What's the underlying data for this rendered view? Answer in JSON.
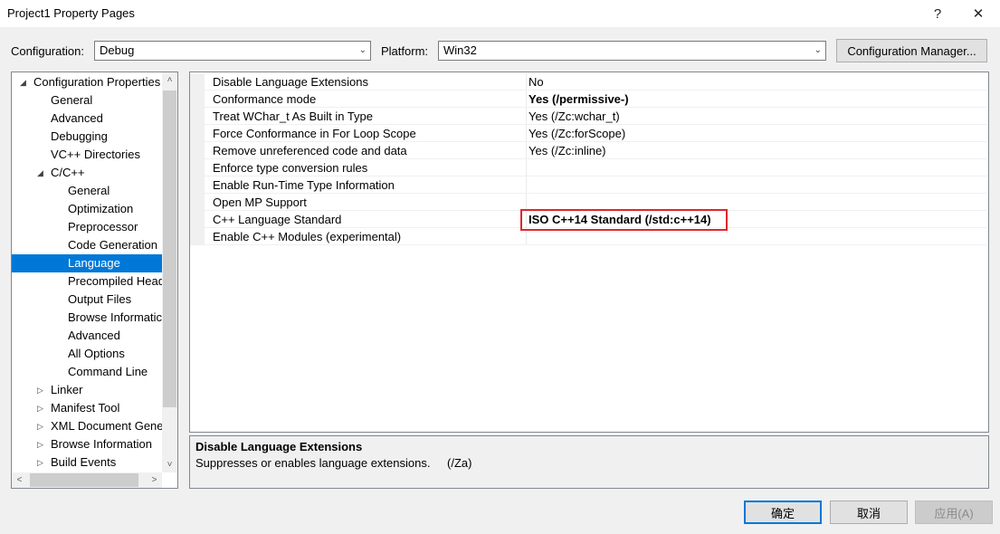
{
  "window": {
    "title": "Project1 Property Pages",
    "help_glyph": "?",
    "close_glyph": "✕"
  },
  "toolbar": {
    "configuration_label": "Configuration:",
    "configuration_value": "Debug",
    "platform_label": "Platform:",
    "platform_value": "Win32",
    "config_manager_label": "Configuration Manager..."
  },
  "tree": {
    "items": [
      {
        "label": "Configuration Properties",
        "expander": "◢"
      },
      {
        "label": "General"
      },
      {
        "label": "Advanced"
      },
      {
        "label": "Debugging"
      },
      {
        "label": "VC++ Directories"
      },
      {
        "label": "C/C++",
        "expander": "◢"
      },
      {
        "label": "General"
      },
      {
        "label": "Optimization"
      },
      {
        "label": "Preprocessor"
      },
      {
        "label": "Code Generation"
      },
      {
        "label": "Language"
      },
      {
        "label": "Precompiled Head"
      },
      {
        "label": "Output Files"
      },
      {
        "label": "Browse Informatic"
      },
      {
        "label": "Advanced"
      },
      {
        "label": "All Options"
      },
      {
        "label": "Command Line"
      },
      {
        "label": "Linker",
        "expander": "▷"
      },
      {
        "label": "Manifest Tool",
        "expander": "▷"
      },
      {
        "label": "XML Document Gene",
        "expander": "▷"
      },
      {
        "label": "Browse Information",
        "expander": "▷"
      },
      {
        "label": "Build Events",
        "expander": "▷"
      }
    ]
  },
  "grid": {
    "rows": [
      {
        "name": "Disable Language Extensions",
        "value": "No"
      },
      {
        "name": "Conformance mode",
        "value": "Yes (/permissive-)"
      },
      {
        "name": "Treat WChar_t As Built in Type",
        "value": "Yes (/Zc:wchar_t)"
      },
      {
        "name": "Force Conformance in For Loop Scope",
        "value": "Yes (/Zc:forScope)"
      },
      {
        "name": "Remove unreferenced code and data",
        "value": "Yes (/Zc:inline)"
      },
      {
        "name": "Enforce type conversion rules",
        "value": ""
      },
      {
        "name": "Enable Run-Time Type Information",
        "value": ""
      },
      {
        "name": "Open MP Support",
        "value": ""
      },
      {
        "name": "C++ Language Standard",
        "value": "ISO C++14 Standard (/std:c++14)"
      },
      {
        "name": "Enable C++ Modules (experimental)",
        "value": ""
      }
    ]
  },
  "description": {
    "title": "Disable Language Extensions",
    "text": "Suppresses or enables language extensions.",
    "switch": "(/Za)"
  },
  "buttons": {
    "ok": "确定",
    "cancel": "取消",
    "apply": "应用(A)"
  },
  "colors": {
    "selection": "#0078d7",
    "highlight_border": "#e0262b"
  }
}
